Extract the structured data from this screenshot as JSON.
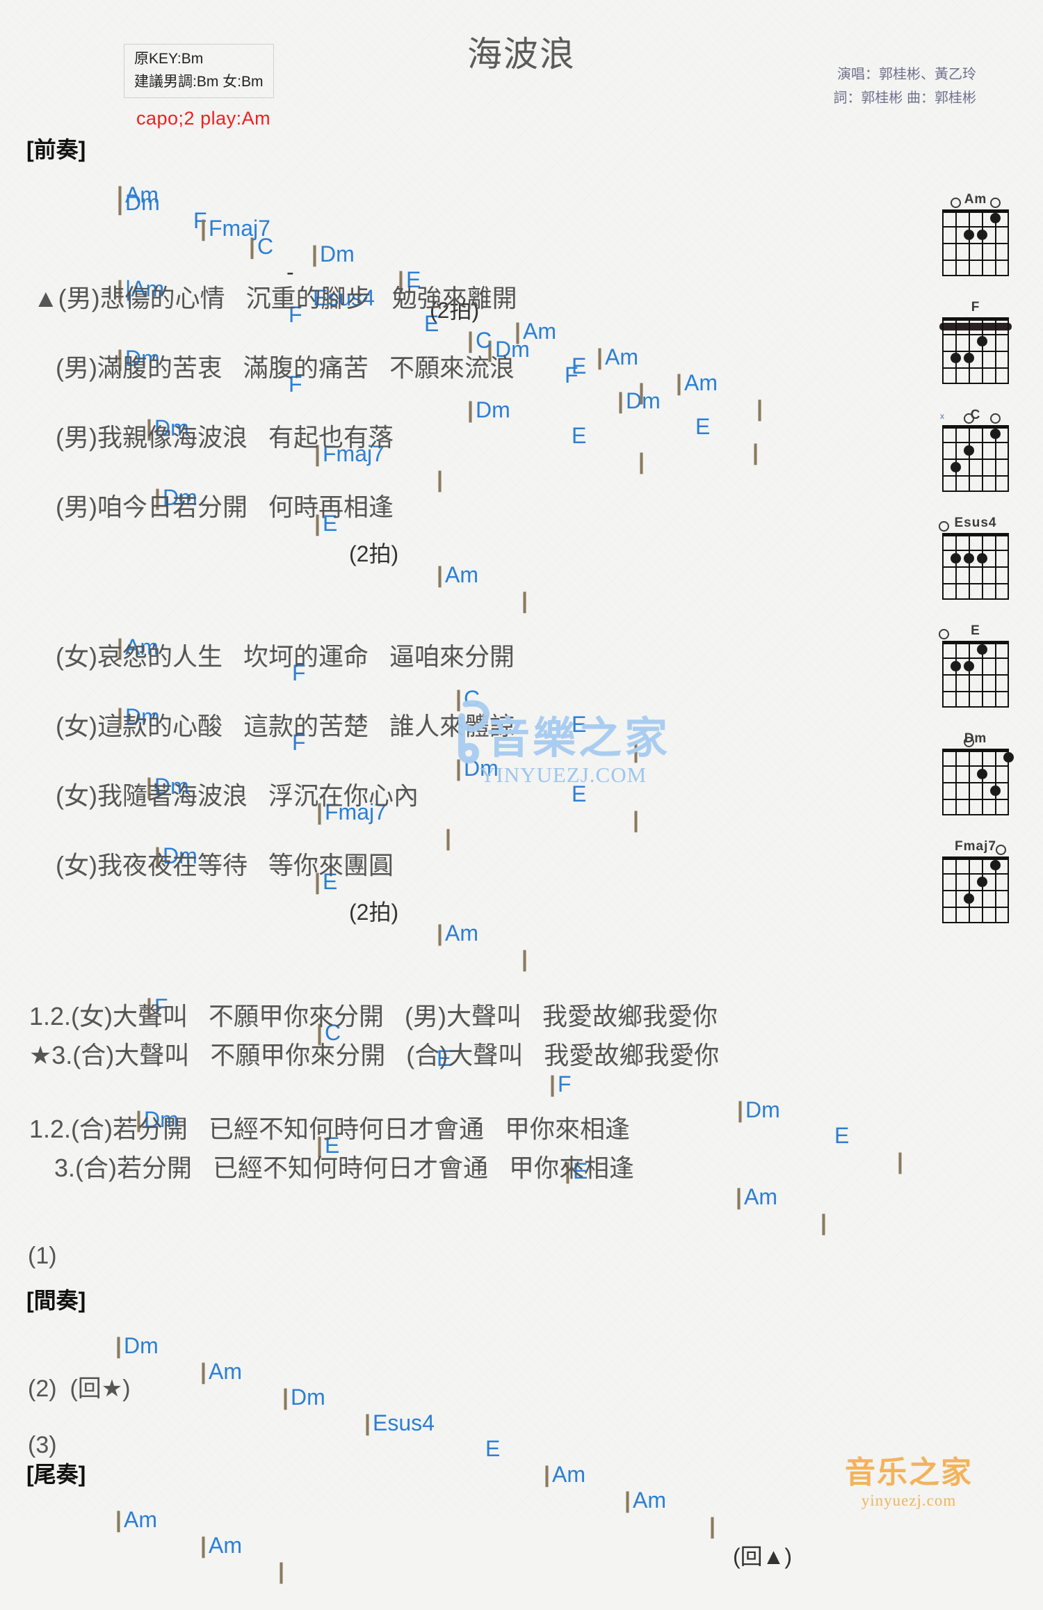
{
  "header": {
    "title": "海波浪",
    "key_original": "原KEY:Bm",
    "key_suggested": "建議男調:Bm 女:Bm",
    "capo": "capo;2 play:Am",
    "singer": "演唱：郭桂彬、黃乙玲",
    "writers": "詞：郭桂彬  曲：郭桂彬"
  },
  "watermark": {
    "cn": "音樂之家",
    "url": "yinyuezj.com",
    "bottom_cn": "音乐之家",
    "bottom_url": "yinyuezj.com"
  },
  "sections": {
    "intro_label": "[前奏]",
    "interlude_label": "[間奏]",
    "outro_label": "[尾奏]",
    "intro_line1": "|Am   F   |C - Esus4   E   |Dm   F   |Dm   E   |",
    "intro_line2": "|Dm   |Fmaj7   |Dm   |E (2拍) |Am   |Am   |Am   |",
    "interlude_line": "[間奏] |Dm  |Am  |Dm  |Esus4  E  |Am  |Am  | (回▲)",
    "outro_line": "[尾奏] |Am   |Am   |",
    "repeat1": "(1)",
    "repeat2": "(2)  (回★)",
    "repeat3": "(3)"
  },
  "verse_male": {
    "chords_1": [
      "|Am",
      "F",
      "|C",
      "E",
      "|"
    ],
    "lyric_1": "▲(男)悲傷的心情   沉重的腳步   勉強來離開",
    "chords_2": [
      "|Dm",
      "F",
      "|Dm",
      "E",
      "|"
    ],
    "lyric_2": "(男)滿腹的苦衷   滿腹的痛苦   不願來流浪",
    "chords_3": [
      "|Dm",
      "|Fmaj7",
      "|"
    ],
    "lyric_3": "(男)我親像海波浪   有起也有落",
    "chords_4": [
      "|Dm",
      "|E",
      "(2拍)",
      "|Am",
      "|"
    ],
    "lyric_4": "(男)咱今日若分開   何時再相逢"
  },
  "verse_female": {
    "chords_1": [
      "|Am",
      "F",
      "|C",
      "E",
      "|"
    ],
    "lyric_1": "(女)哀怨的人生   坎坷的運命   逼咱來分開",
    "chords_2": [
      "|Dm",
      "F",
      "|Dm",
      "E",
      "|"
    ],
    "lyric_2": "(女)這款的心酸   這款的苦楚   誰人來體諒",
    "chords_3": [
      "|Dm",
      "|Fmaj7",
      "|"
    ],
    "lyric_3": "(女)我隨著海波浪   浮沉在你心內",
    "chords_4": [
      "|Dm",
      "|E",
      "(2拍)",
      "|Am",
      "|"
    ],
    "lyric_4": "(女)我夜夜在等待   等你來團圓"
  },
  "chorus": {
    "chords_1": [
      "|F",
      "|C",
      "E",
      "|F",
      "|Dm",
      "E",
      "|"
    ],
    "lyric_1a": "1.2.(女)大聲叫   不願甲你來分開   (男)大聲叫   我愛故鄉我愛你",
    "lyric_1b": "★3.(合)大聲叫   不願甲你來分開   (合)大聲叫   我愛故鄉我愛你",
    "chords_2": [
      "|Dm",
      "|E",
      "|E",
      "|Am",
      "|"
    ],
    "lyric_2a": "1.2.(合)若分開   已經不知何時何日才會通   甲你來相逢",
    "lyric_2b": "3.(合)若分開   已經不知何時何日才會通   甲你來相逢"
  },
  "chord_diagrams": [
    {
      "name": "Am",
      "frets": [
        [
          2,
          1
        ],
        [
          3,
          2
        ],
        [
          4,
          2
        ]
      ],
      "open": [
        1,
        5
      ],
      "mute": [],
      "barre": null
    },
    {
      "name": "F",
      "frets": [
        [
          3,
          2
        ],
        [
          1,
          3
        ],
        [
          2,
          3
        ]
      ],
      "open": [],
      "mute": [],
      "barre": 1
    },
    {
      "name": "C",
      "frets": [
        [
          2,
          1
        ],
        [
          4,
          2
        ],
        [
          5,
          3
        ]
      ],
      "open": [
        1,
        3
      ],
      "mute": [
        6
      ],
      "barre": null
    },
    {
      "name": "Esus4",
      "frets": [
        [
          2,
          2
        ],
        [
          3,
          2
        ],
        [
          4,
          2
        ]
      ],
      "open": [
        1
      ],
      "mute": [],
      "barre": null
    },
    {
      "name": "E",
      "frets": [
        [
          3,
          1
        ],
        [
          4,
          2
        ],
        [
          5,
          2
        ]
      ],
      "open": [
        1
      ],
      "mute": [],
      "barre": null
    },
    {
      "name": "Dm",
      "frets": [
        [
          1,
          1
        ],
        [
          3,
          2
        ],
        [
          2,
          3
        ]
      ],
      "open": [
        4
      ],
      "mute": [],
      "barre": null
    },
    {
      "name": "Fmaj7",
      "frets": [
        [
          2,
          1
        ],
        [
          3,
          2
        ],
        [
          4,
          3
        ]
      ],
      "open": [
        1
      ],
      "mute": [],
      "barre": null
    }
  ]
}
